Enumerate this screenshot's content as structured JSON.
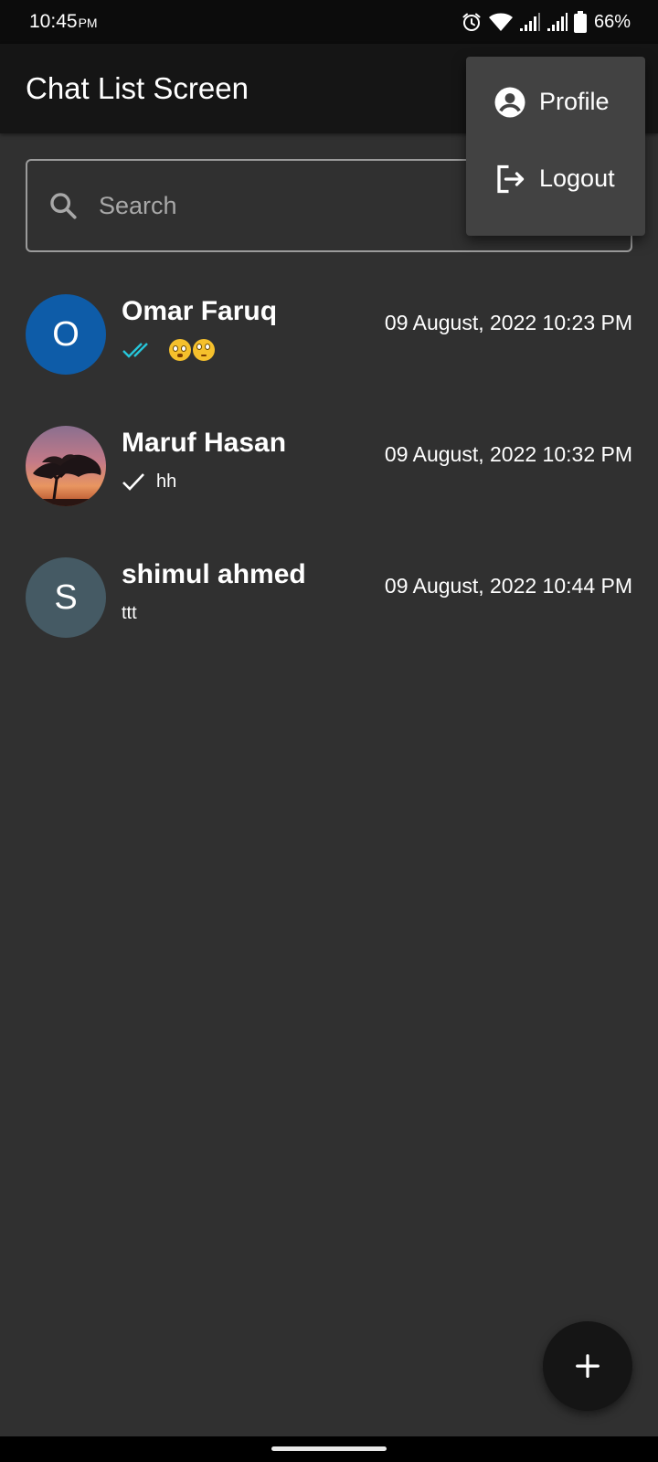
{
  "status_bar": {
    "time": "10:45",
    "time_suffix": "PM",
    "battery": "66%",
    "icons": [
      "alarm-icon",
      "wifi-icon",
      "signal-icon",
      "signal-icon",
      "battery-icon"
    ]
  },
  "app_bar": {
    "title": "Chat List Screen"
  },
  "search": {
    "placeholder": "Search",
    "value": "",
    "icon": "search-icon"
  },
  "menu": {
    "items": [
      {
        "label": "Profile",
        "icon": "account-circle-icon"
      },
      {
        "label": "Logout",
        "icon": "logout-icon"
      }
    ]
  },
  "chats": [
    {
      "name": "Omar Faruq",
      "avatar_letter": "O",
      "avatar_color": "#0e5ca8",
      "last_message": "😳🙄",
      "status_icon": "double-check-icon",
      "status_color": "#26c6da",
      "time": "09 August, 2022 10:23 PM"
    },
    {
      "name": "Maruf Hasan",
      "avatar_letter": "",
      "avatar_type": "photo-sunset-tree",
      "last_message": "hh",
      "status_icon": "check-icon",
      "status_color": "#ffffff",
      "time": "09 August, 2022 10:32 PM"
    },
    {
      "name": "shimul ahmed",
      "avatar_letter": "S",
      "avatar_color": "#455a64",
      "last_message": "ttt",
      "status_icon": "",
      "time": "09 August, 2022 10:44 PM"
    }
  ],
  "fab": {
    "icon": "add-icon"
  },
  "colors": {
    "background": "#303030",
    "app_bar": "#151515",
    "status_bar": "#0c0c0c",
    "menu": "#424242",
    "read_tick": "#26c6da"
  }
}
